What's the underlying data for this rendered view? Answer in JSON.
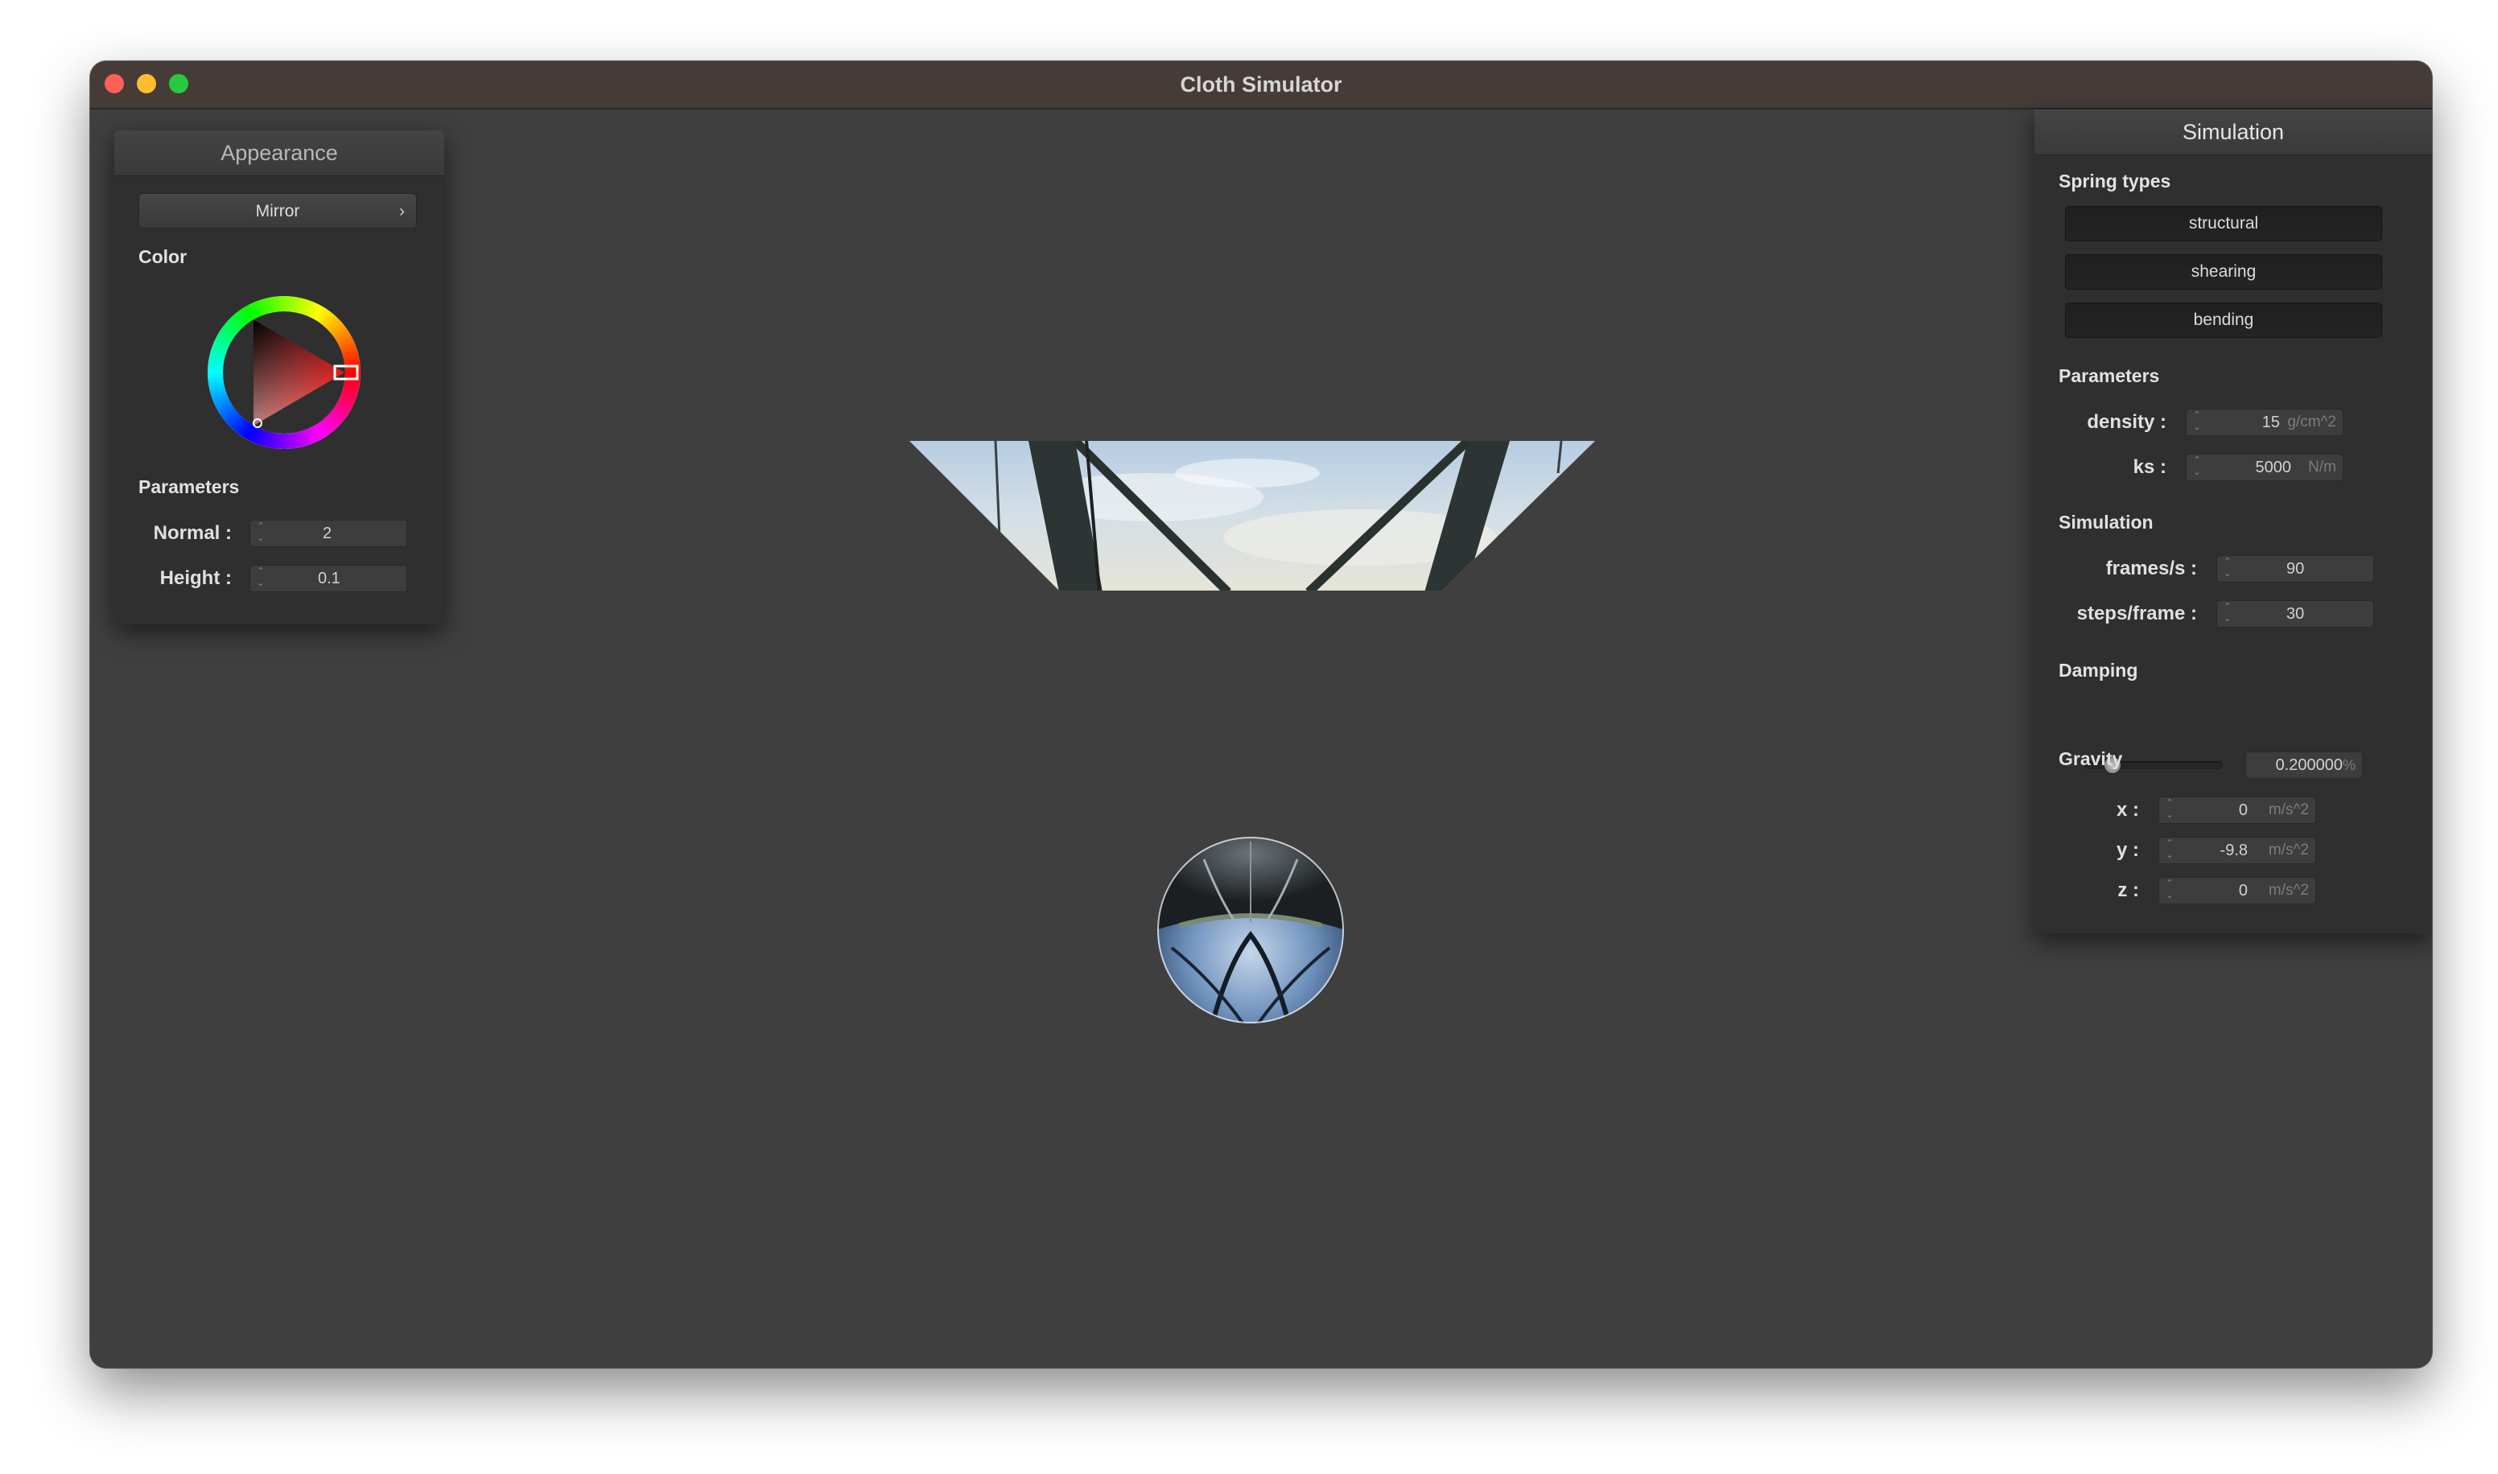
{
  "window": {
    "title": "Cloth Simulator"
  },
  "appearance": {
    "title": "Appearance",
    "shader_select": {
      "value": "Mirror"
    },
    "color_label": "Color",
    "parameters_label": "Parameters",
    "params": [
      {
        "label": "Normal :",
        "value": "2"
      },
      {
        "label": "Height :",
        "value": "0.1"
      }
    ]
  },
  "simulation_panel": {
    "title": "Simulation",
    "spring_types_label": "Spring types",
    "spring_types": [
      "structural",
      "shearing",
      "bending"
    ],
    "parameters_label": "Parameters",
    "params": [
      {
        "label": "density :",
        "value": "15",
        "unit": "g/cm^2"
      },
      {
        "label": "ks :",
        "value": "5000",
        "unit": "N/m"
      }
    ],
    "simulation_label": "Simulation",
    "sim_params": [
      {
        "label": "frames/s :",
        "value": "90"
      },
      {
        "label": "steps/frame :",
        "value": "30"
      }
    ],
    "damping_label": "Damping",
    "damping": {
      "value": "0.200000",
      "unit": "%",
      "slider_fraction": 0.2
    },
    "gravity_label": "Gravity",
    "gravity": [
      {
        "label": "x :",
        "value": "0",
        "unit": "m/s^2"
      },
      {
        "label": "y :",
        "value": "-9.8",
        "unit": "m/s^2"
      },
      {
        "label": "z :",
        "value": "0",
        "unit": "m/s^2"
      }
    ]
  },
  "colors": {
    "background": "#3f3f3f",
    "panel": "#2f2f2f",
    "titlebar": "#453c38",
    "selected_color": "#ff2a2a"
  }
}
